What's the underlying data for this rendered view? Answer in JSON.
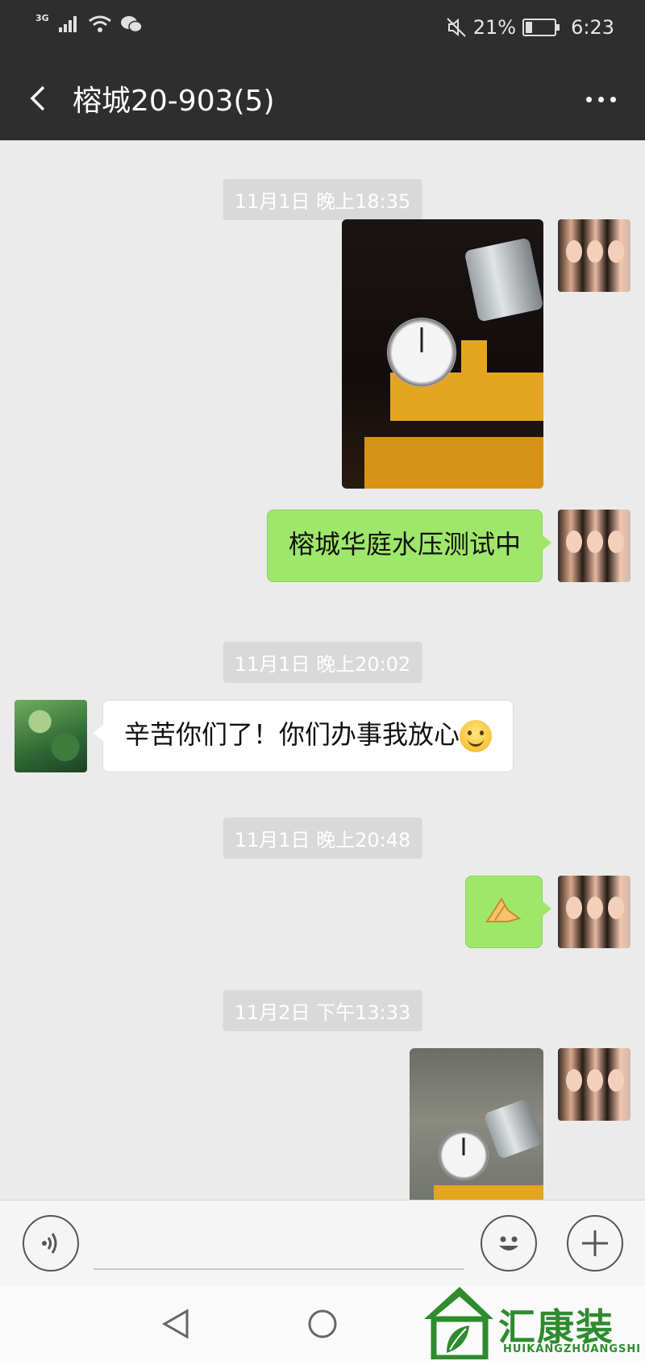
{
  "status_bar": {
    "network": "3G",
    "battery_percent": "21%",
    "battery_level": 0.21,
    "time": "6:23"
  },
  "header": {
    "title": "榕城20-903(5)"
  },
  "messages": {
    "ts1": "11月1日 晚上18:35",
    "text1": "榕城华庭水压测试中",
    "ts2": "11月1日 晚上20:02",
    "text2": "辛苦你们了！你们办事我放心",
    "ts3": "11月1日 晚上20:48",
    "ts4": "11月2日 下午13:33"
  },
  "watermark": {
    "name": "汇康装饰",
    "pinyin": "HUIKANGZHUANGSHI"
  },
  "icons": [
    "signal-icon",
    "wifi-icon",
    "wechat-icon",
    "mute-icon",
    "battery-icon",
    "back-icon",
    "more-icon",
    "voice-icon",
    "emoji-icon",
    "plus-icon",
    "nav-back-icon",
    "nav-home-icon"
  ],
  "colors": {
    "header_bg": "#2e2e2e",
    "chat_bg": "#ebebeb",
    "own_bubble": "#9fe76a",
    "other_bubble": "#ffffff",
    "logo_green": "#2e8b2e"
  }
}
